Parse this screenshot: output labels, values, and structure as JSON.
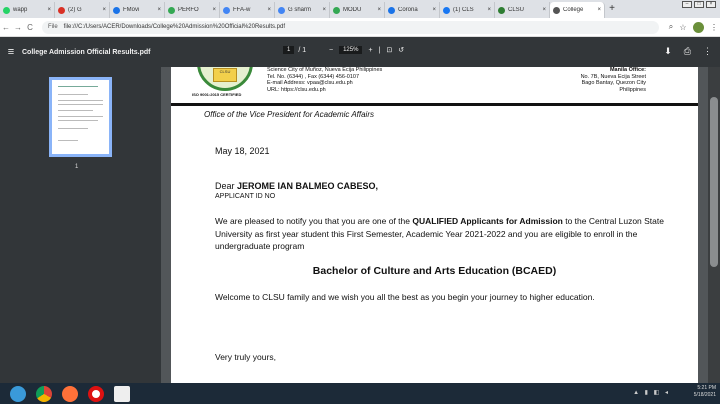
{
  "browser": {
    "tabs": [
      {
        "label": "wapp",
        "color": "#25d366"
      },
      {
        "label": "(2) G",
        "color": "#d93025"
      },
      {
        "label": "FMovi",
        "color": "#1a73e8"
      },
      {
        "label": "PERFO",
        "color": "#34a853"
      },
      {
        "label": "FFA-w",
        "color": "#4285f4"
      },
      {
        "label": "G sharm",
        "color": "#4285f4"
      },
      {
        "label": "MODU",
        "color": "#34a853"
      },
      {
        "label": "Corona",
        "color": "#1a73e8"
      },
      {
        "label": "(1) CLS",
        "color": "#1877f2"
      },
      {
        "label": "CLSU",
        "color": "#2e7d32"
      },
      {
        "label": "College",
        "color": "#555555"
      }
    ],
    "new_tab": "+",
    "url_prefix": "File",
    "url": "file:///C:/Users/ACER/Downloads/College%20Admission%20Official%20Results.pdf"
  },
  "pdf_toolbar": {
    "title": "College Admission Official Results.pdf",
    "page_current": "1",
    "page_total": "/ 1",
    "zoom": "125%",
    "zoom_out": "−",
    "zoom_in": "+"
  },
  "sidebar": {
    "thumbnail_page": "1"
  },
  "document": {
    "iso": "ISO 9001:2015 CERTIFIED",
    "header_left": [
      "Science City of Muñoz, Nueva Ecija Philippines",
      "Tel. No. (6344)      , Fax (6344) 456-0107",
      "E-mail Address: vpaa@clsu.edu.ph",
      "URL: https://clsu.edu.ph"
    ],
    "header_right_title": "Manila Office:",
    "header_right": [
      "No. 7B, Nueva Ecija Street",
      "Bago Bantay, Quezon City",
      "Philippines"
    ],
    "office": "Office of the Vice President for Academic Affairs",
    "date": "May 18, 2021",
    "dear": "Dear",
    "applicant_name": "JEROME IAN BALMEO CABESO,",
    "applicant_id": "APPLICANT ID NO",
    "body1_a": "We are pleased to notify you that you are one of the ",
    "body1_b": "QUALIFIED Applicants for Admission",
    "body1_c": " to the Central Luzon State University as first year student this First Semester, Academic Year 2021-2022 and you are eligible to enroll in the undergraduate program",
    "program": "Bachelor of Culture and Arts Education (BCAED)",
    "body2": "Welcome to CLSU family and we wish you all the best as you begin your journey to higher education.",
    "closing": "Very truly yours,"
  },
  "taskbar": {
    "time": "5:21 PM",
    "date": "5/18/2021"
  }
}
